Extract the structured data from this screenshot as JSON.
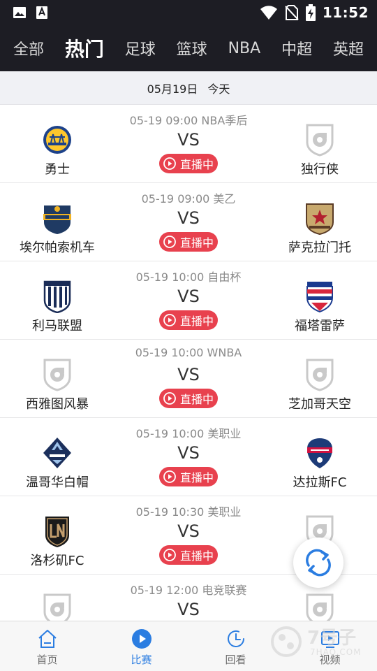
{
  "status_bar": {
    "time": "11:52"
  },
  "tabs": [
    {
      "label": "全部",
      "active": false
    },
    {
      "label": "热门",
      "active": true
    },
    {
      "label": "足球",
      "active": false
    },
    {
      "label": "篮球",
      "active": false
    },
    {
      "label": "NBA",
      "active": false
    },
    {
      "label": "中超",
      "active": false
    },
    {
      "label": "英超",
      "active": false
    }
  ],
  "date_header": {
    "date": "05月19日",
    "day": "今天"
  },
  "matches": [
    {
      "info": "05-19 09:00 NBA季后",
      "vs": "VS",
      "live": "直播中",
      "home": {
        "name": "勇士",
        "logo": "warriors-logo"
      },
      "away": {
        "name": "独行侠",
        "logo": "placeholder-logo"
      }
    },
    {
      "info": "05-19 09:00 美乙",
      "vs": "VS",
      "live": "直播中",
      "home": {
        "name": "埃尔帕索机车",
        "logo": "locomotive-logo"
      },
      "away": {
        "name": "萨克拉门托",
        "logo": "republic-fc-logo"
      }
    },
    {
      "info": "05-19 10:00 自由杯",
      "vs": "VS",
      "live": "直播中",
      "home": {
        "name": "利马联盟",
        "logo": "alianza-lima-logo"
      },
      "away": {
        "name": "福塔雷萨",
        "logo": "fortaleza-logo"
      }
    },
    {
      "info": "05-19 10:00 WNBA",
      "vs": "VS",
      "live": "直播中",
      "home": {
        "name": "西雅图风暴",
        "logo": "placeholder-logo"
      },
      "away": {
        "name": "芝加哥天空",
        "logo": "placeholder-logo"
      }
    },
    {
      "info": "05-19 10:00 美职业",
      "vs": "VS",
      "live": "直播中",
      "home": {
        "name": "温哥华白帽",
        "logo": "whitecaps-logo"
      },
      "away": {
        "name": "达拉斯FC",
        "logo": "fc-dallas-logo"
      }
    },
    {
      "info": "05-19 10:30 美职业",
      "vs": "VS",
      "live": "直播中",
      "home": {
        "name": "洛杉矶FC",
        "logo": "lafc-logo"
      },
      "away": {
        "name": "",
        "logo": "placeholder-logo"
      }
    },
    {
      "info": "05-19 12:00 电竞联赛",
      "vs": "VS",
      "live": "",
      "home": {
        "name": "",
        "logo": "placeholder-logo"
      },
      "away": {
        "name": "",
        "logo": "placeholder-logo"
      }
    }
  ],
  "bottom_nav": [
    {
      "label": "首页",
      "icon": "home-icon",
      "active": false
    },
    {
      "label": "比赛",
      "icon": "play-icon",
      "active": true
    },
    {
      "label": "回看",
      "icon": "replay-icon",
      "active": false
    },
    {
      "label": "视频",
      "icon": "video-icon",
      "active": false
    }
  ],
  "watermark": {
    "text": "7号子",
    "sub": "7HAO.COM"
  },
  "colors": {
    "header_bg": "#1d1d24",
    "live_red": "#e8414e",
    "accent_blue": "#2b7de1"
  }
}
